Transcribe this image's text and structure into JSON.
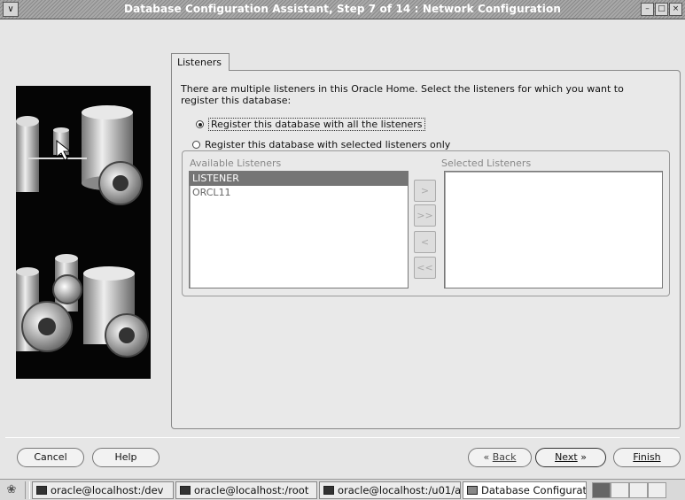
{
  "window": {
    "title": "Database Configuration Assistant, Step 7 of 14 : Network Configuration",
    "menu_icon": "∨",
    "controls": [
      "–",
      "□",
      "×"
    ]
  },
  "tab": {
    "label": "Listeners"
  },
  "description": "There are multiple listeners in this Oracle Home. Select the listeners for which you want to register this database:",
  "options": {
    "all": "Register this database with all the listeners",
    "selected": "Register this database with selected listeners only",
    "selected_option": "all"
  },
  "available": {
    "label": "Available Listeners",
    "items": [
      "LISTENER",
      "ORCL11"
    ]
  },
  "selected": {
    "label": "Selected Listeners",
    "items": []
  },
  "move_buttons": [
    ">",
    ">>",
    "<",
    "<<"
  ],
  "buttons": {
    "cancel": "Cancel",
    "help": "Help",
    "back": "Back",
    "next": "Next",
    "finish": "Finish"
  },
  "taskbar": {
    "tasks": [
      "oracle@localhost:/dev",
      "oracle@localhost:/root",
      "oracle@localhost:/u01/a",
      "Database Configuration"
    ]
  },
  "colors": {
    "selection": "#757575",
    "art_background": "#050505"
  }
}
